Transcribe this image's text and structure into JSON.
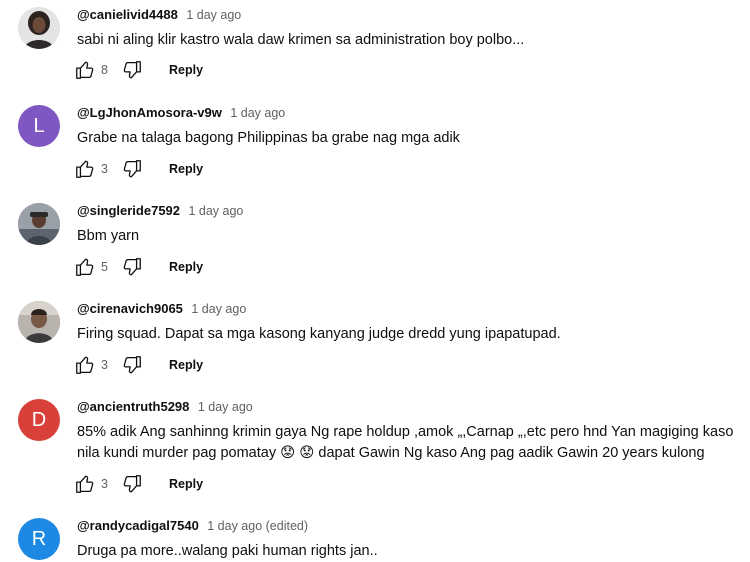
{
  "comments": [
    {
      "author": "@canielivid4488",
      "time": "1 day ago",
      "text": "sabi ni aling klir kastro wala daw krimen sa administration boy polbo...",
      "likes": "8",
      "reply_label": "Reply",
      "avatar": {
        "type": "photo",
        "bg": "#d9d9d9"
      }
    },
    {
      "author": "@LgJhonAmosora-v9w",
      "time": "1 day ago",
      "text": "Grabe na talaga bagong Philippinas ba grabe nag mga adik",
      "likes": "3",
      "reply_label": "Reply",
      "avatar": {
        "type": "letter",
        "letter": "L",
        "bg": "#7e57c2"
      }
    },
    {
      "author": "@singleride7592",
      "time": "1 day ago",
      "text": "Bbm yarn",
      "likes": "5",
      "reply_label": "Reply",
      "avatar": {
        "type": "photo",
        "bg": "#8a8f9a"
      }
    },
    {
      "author": "@cirenavich9065",
      "time": "1 day ago",
      "text": "Firing squad. Dapat sa mga kasong kanyang judge dredd yung ipapatupad.",
      "likes": "3",
      "reply_label": "Reply",
      "avatar": {
        "type": "photo",
        "bg": "#6b6b6b"
      }
    },
    {
      "author": "@ancientruth5298",
      "time": "1 day ago",
      "text_lines": [
        "85% adik Ang sanhinng krimin gaya Ng rape holdup  ,amok „,Carnap „,etc pero hnd Yan magiging kaso",
        "nila kundi murder pag pomatay 😟 😟 dapat Gawin Ng kaso Ang pag aadik Gawin 20 years kulong"
      ],
      "likes": "3",
      "reply_label": "Reply",
      "avatar": {
        "type": "letter",
        "letter": "D",
        "bg": "#d9403a"
      }
    },
    {
      "author": "@randycadigal7540",
      "time": "1 day ago (edited)",
      "text": "Druga pa more..walang paki human rights jan..",
      "avatar": {
        "type": "letter",
        "letter": "R",
        "bg": "#1e88e5"
      }
    }
  ],
  "icons": {
    "like": "thumbs-up-icon",
    "dislike": "thumbs-down-icon"
  }
}
